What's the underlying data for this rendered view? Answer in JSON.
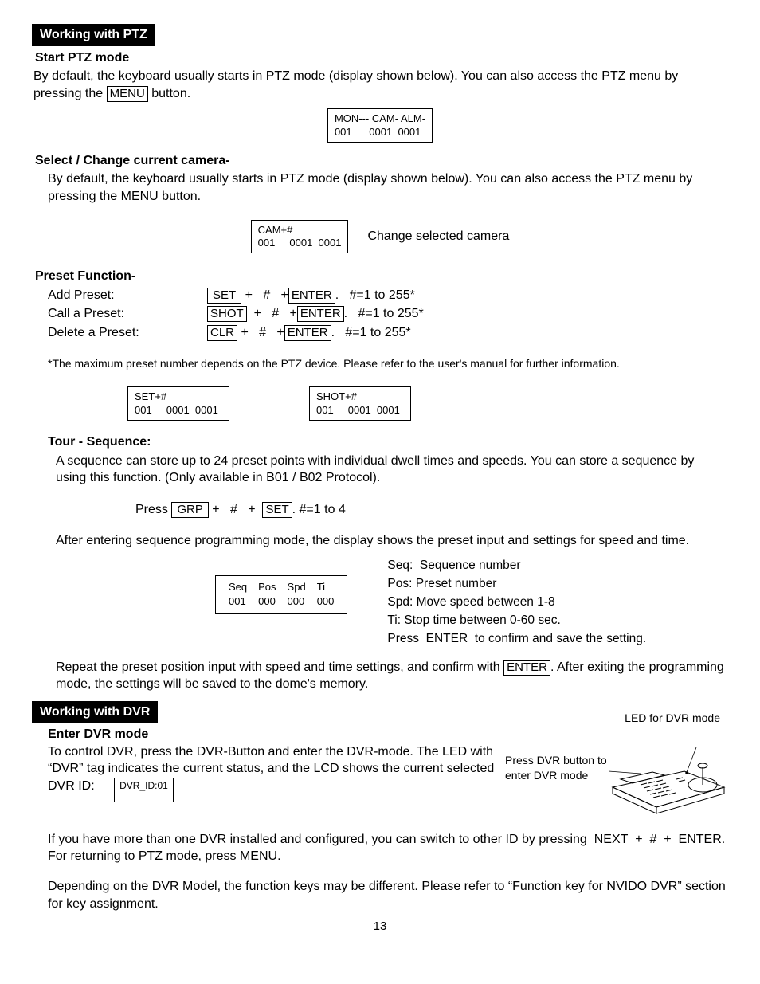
{
  "ptz": {
    "sectionTitle": "Working with PTZ",
    "startHead": "Start PTZ mode",
    "startPara": "By default, the keyboard usually starts in PTZ mode (display shown below). You can also access the PTZ menu by pressing the ",
    "startParaAfterKey": " button.",
    "menuKey": "MENU",
    "lcd1Line1": "MON--- CAM- ALM-",
    "lcd1Line2": "001      0001  0001",
    "selectHead": "Select / Change current camera-",
    "selectPara": "By default, the keyboard usually starts in PTZ mode (display shown below). You can also access the PTZ menu by pressing the MENU button.",
    "lcd2Line1": "CAM+#",
    "lcd2Line2": "001     0001  0001",
    "changeCameraLabel": "Change selected camera",
    "presetHead": "Preset Function-",
    "addPresetLabel": "Add Preset:",
    "callPresetLabel": "Call a Preset:",
    "deletePresetLabel": "Delete a Preset:",
    "setKey": "SET",
    "addPresetMid": " +   #   +",
    "enterKey": "ENTER",
    "addPresetTail": ".   #=1 to 255*",
    "shotKey": "SHOT",
    "callPresetMid": "  +   #   +",
    "callPresetTail": ".   #=1 to 255*",
    "clrKey": "CLR",
    "deletePresetMid": " +   #   +",
    "deletePresetTail": ".   #=1 to 255*",
    "presetNote": "*The maximum preset number depends on the PTZ device. Please refer to the user's manual for further information.",
    "lcd3Line1": "SET+#",
    "lcd3Line2": "001     0001  0001",
    "lcd4Line1": "SHOT+#",
    "lcd4Line2": "001     0001  0001",
    "tourHead": "Tour - Sequence:",
    "tourPara": "A sequence can store up to 24 preset points with individual dwell times and speeds. You can store a sequence by using this function. (Only available in B01 / B02 Protocol).",
    "tourPress": "Press ",
    "grpKey": "GRP",
    "tourMid": " +   #   +  ",
    "tourSetKey": "SET",
    "tourTail": ". #=1 to 4",
    "tourAfter": "After entering sequence programming mode, the display shows the preset input and settings for speed and time.",
    "seqHead1": "Seq",
    "seqHead2": "Pos",
    "seqHead3": "Spd",
    "seqHead4": "Ti",
    "seqVal1": "001",
    "seqVal2": "000",
    "seqVal3": "000",
    "seqVal4": "000",
    "legendSeq": "Seq:  Sequence number",
    "legendPos": "Pos: Preset number",
    "legendSpd": "Spd: Move speed between 1-8",
    "legendTi": "Ti: Stop time between 0-60 sec.",
    "legendPress": "Press  ENTER  to confirm and save the setting.",
    "tourRepeat1": "Repeat the preset position input with speed and time settings, and confirm with ",
    "tourRepeat2": ". After exiting the programming mode, the settings will be saved to the dome's memory."
  },
  "dvr": {
    "sectionTitle": "Working with DVR",
    "ledLabel": "LED for DVR mode",
    "enterHead": "Enter DVR mode",
    "para1": "To control DVR, press the DVR-Button and enter the DVR-mode. The LED with “DVR” tag indicates the current status, and the LCD shows the current selected DVR ID:",
    "pressLabel1": "Press DVR button to",
    "pressLabel2": "enter DVR mode",
    "lcdDvr": "DVR_ID:01",
    "para2": "If you have more than one DVR installed and configured, you can switch to other ID by pressing  NEXT  +  #  +  ENTER. For returning to PTZ mode, press MENU.",
    "para3": "Depending on the DVR Model, the function keys may be different. Please refer to “Function key for NVIDO DVR” section for key assignment."
  },
  "pageNumber": "13"
}
